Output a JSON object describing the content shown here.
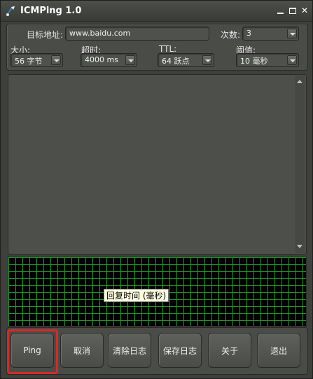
{
  "window": {
    "title": "ICMPing 1.0"
  },
  "params": {
    "target_label": "目标地址:",
    "target_value": "www.baidu.com",
    "count_label": "次数:",
    "count_value": "3",
    "size_label": "大小:",
    "size_value": "56 字节",
    "timeout_label": "超时:",
    "timeout_value": "4000 ms",
    "ttl_label": "TTL:",
    "ttl_value": "64 跃点",
    "threshold_label": "阈值:",
    "threshold_value": "10 毫秒"
  },
  "graph": {
    "tooltip": "回复时间 (毫秒)",
    "grid_color": "#1f9d2a"
  },
  "buttons": {
    "ping": "Ping",
    "cancel": "取消",
    "clear_log": "清除日志",
    "save_log": "保存日志",
    "about": "关于",
    "exit": "退出"
  },
  "colors": {
    "highlight": "#d42a2a"
  }
}
